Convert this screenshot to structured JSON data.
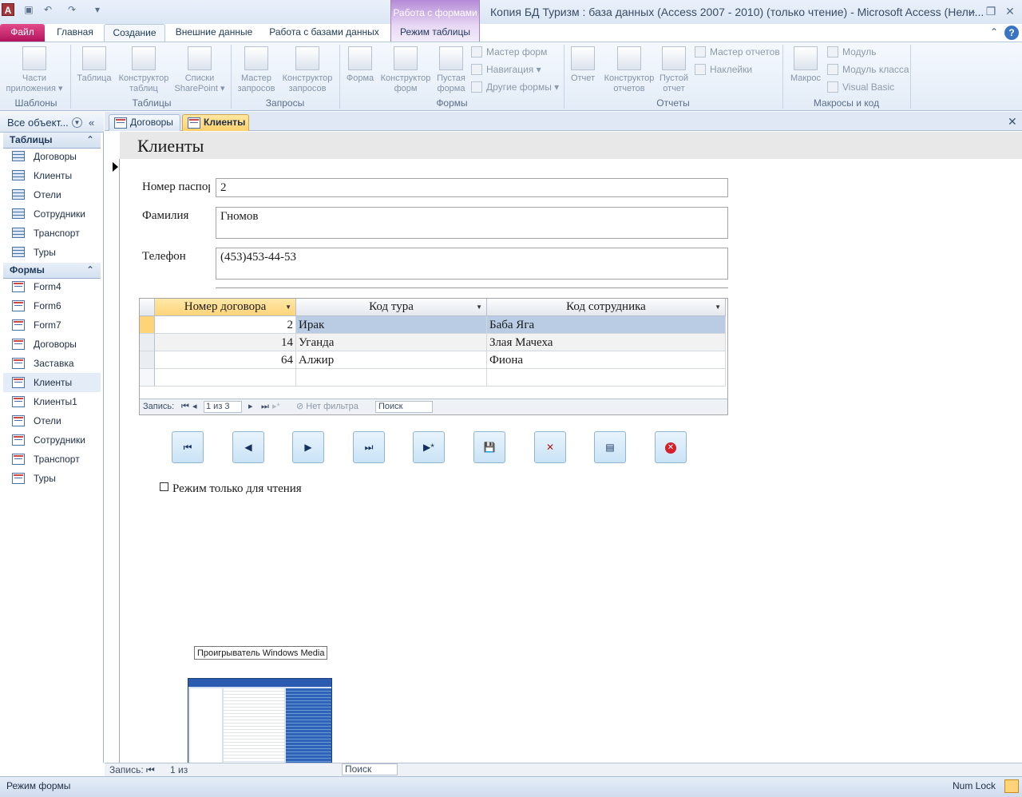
{
  "titlebar": {
    "app_icon": "A",
    "context_group": "Работа с формами",
    "title": "Копия БД Туризм : база данных (Access 2007 - 2010) (только чтение)  -  Microsoft Access (Нели...",
    "qat_icons": [
      "save-icon",
      "undo-icon",
      "redo-icon",
      "customize-qat-icon"
    ]
  },
  "ribbon_tabs": [
    "Файл",
    "Главная",
    "Создание",
    "Внешние данные",
    "Работа с базами данных",
    "Режим таблицы"
  ],
  "ribbon": {
    "groups": {
      "templates": "Шаблоны",
      "tables": "Таблицы",
      "queries": "Запросы",
      "forms": "Формы",
      "reports": "Отчеты",
      "macros": "Макросы и код"
    },
    "templates_btn": [
      "Части",
      "приложения ▾"
    ],
    "table_btn": [
      "Таблица"
    ],
    "table_designer_btn": [
      "Конструктор",
      "таблиц"
    ],
    "sharepoint_btn": [
      "Списки",
      "SharePoint ▾"
    ],
    "query_wizard_btn": [
      "Мастер",
      "запросов"
    ],
    "query_designer_btn": [
      "Конструктор",
      "запросов"
    ],
    "form_btn": [
      "Форма"
    ],
    "form_designer_btn": [
      "Конструктор",
      "форм"
    ],
    "blank_form_btn": [
      "Пустая",
      "форма"
    ],
    "form_wizard": "Мастер форм",
    "navigation": "Навигация ▾",
    "more_forms": "Другие формы ▾",
    "report_btn": [
      "Отчет"
    ],
    "report_designer_btn": [
      "Конструктор",
      "отчетов"
    ],
    "blank_report_btn": [
      "Пустой",
      "отчет"
    ],
    "report_wizard": "Мастер отчетов",
    "labels": "Наклейки",
    "macro_btn": [
      "Макрос"
    ],
    "module": "Модуль",
    "class_module": "Модуль класса",
    "visual_basic": "Visual Basic"
  },
  "nav": {
    "title": "Все объект...",
    "tables_header": "Таблицы",
    "tables": [
      "Договоры",
      "Клиенты",
      "Отели",
      "Сотрудники",
      "Транспорт",
      "Туры"
    ],
    "forms_header": "Формы",
    "forms": [
      "Form4",
      "Form6",
      "Form7",
      "Договоры",
      "Заставка",
      "Клиенты",
      "Клиенты1",
      "Отели",
      "Сотрудники",
      "Транспорт",
      "Туры"
    ],
    "selected_form": "Клиенты"
  },
  "doc_tabs": [
    "Договоры",
    "Клиенты"
  ],
  "form": {
    "title": "Клиенты",
    "fields": {
      "passport_label": "Номер паспорта",
      "passport_value": "2",
      "surname_label": "Фамилия",
      "surname_value": "Гномов",
      "phone_label": "Телефон",
      "phone_value": "(453)453-44-53"
    },
    "subform": {
      "columns": [
        "Номер договора",
        "Код тура",
        "Код сотрудника"
      ],
      "rows": [
        [
          "2",
          "Ирак",
          "Баба Яга"
        ],
        [
          "14",
          "Уганда",
          "Злая Мачеха"
        ],
        [
          "64",
          "Алжир",
          "Фиона"
        ]
      ],
      "nav": {
        "record_label": "Запись:",
        "position": "1 из 3",
        "filter": "Нет фильтра",
        "search": "Поиск"
      }
    },
    "buttons": [
      "first-record",
      "prev-record",
      "next-record",
      "last-record",
      "new-record",
      "save-record",
      "delete-record",
      "open-form",
      "close-form"
    ],
    "readonly_label": "Режим только для чтения"
  },
  "tooltip": "Проигрыватель Windows Media",
  "bottom_nav": {
    "record_label": "Запись:",
    "position": "1 из",
    "search": "Поиск"
  },
  "status": {
    "left": "Режим формы",
    "num_lock": "Num Lock"
  },
  "colors": {
    "file_tab": "#c2185b",
    "context_group": "#b48ad6",
    "active_tab": "#ffd06b"
  }
}
